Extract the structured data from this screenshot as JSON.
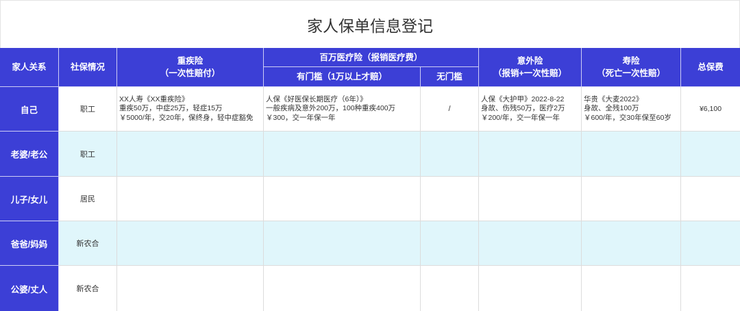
{
  "title": "家人保单信息登记",
  "colors": {
    "header_bg": "#3c3fd6",
    "header_text": "#ffffff",
    "stripe_bg": "#e0f6fb",
    "row_bg": "#ffffff",
    "grid_line": "#dcdcdc",
    "body_text": "#333333"
  },
  "header": {
    "relation": "家人关系",
    "social_security": "社保情况",
    "critical_illness": {
      "title": "重疾险",
      "subtitle": "（一次性赔付）"
    },
    "medical": {
      "title": "百万医疗险（报销医疗费）",
      "with_deductible": "有门槛（1万以上才赔）",
      "no_deductible": "无门槛"
    },
    "accident": {
      "title": "意外险",
      "subtitle": "（报销+一次性赔）"
    },
    "life": {
      "title": "寿险",
      "subtitle": "（死亡一次性赔）"
    },
    "total_premium": "总保费"
  },
  "rows": [
    {
      "relation": "自己",
      "social_security": "职工",
      "critical_illness": [
        "XX人寿《XX重疾险》",
        "重疾50万，中症25万，轻症15万",
        "￥5000/年，交20年，保终身，轻中症豁免"
      ],
      "medical_with_deductible": [
        "人保《好医保长期医疗（6年）》",
        "一般疾病及意外200万，100种重疾400万",
        "￥300，交一年保一年"
      ],
      "medical_no_deductible": "/",
      "accident": [
        "人保《大护甲》2022-8-22",
        "身故、伤残50万，医疗2万",
        "￥200/年，交一年保一年"
      ],
      "life": [
        "华贵《大麦2022》",
        "身故、全残100万",
        "￥600/年，交30年保至60岁"
      ],
      "total_premium": "¥6,100"
    },
    {
      "relation": "老婆/老公",
      "social_security": "职工"
    },
    {
      "relation": "儿子/女儿",
      "social_security": "居民"
    },
    {
      "relation": "爸爸/妈妈",
      "social_security": "新农合"
    },
    {
      "relation": "公婆/丈人",
      "social_security": "新农合"
    }
  ]
}
